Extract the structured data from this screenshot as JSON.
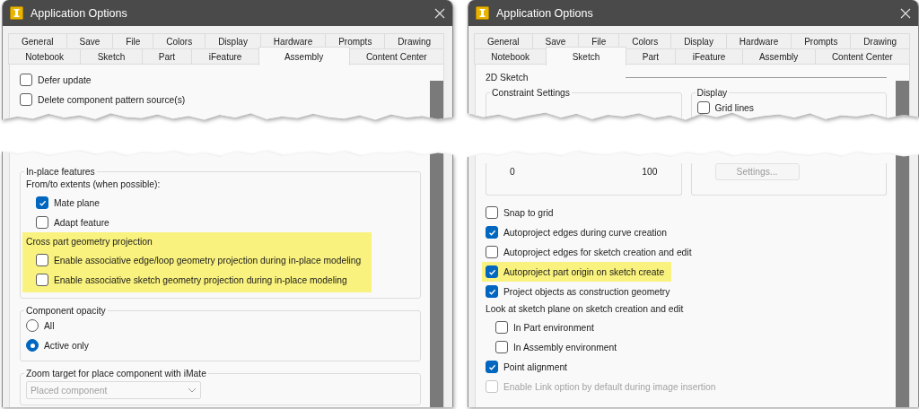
{
  "dialogs": [
    {
      "title": "Application Options",
      "tab_rows": [
        [
          {
            "label": "General",
            "selected": false
          },
          {
            "label": "Save",
            "selected": false
          },
          {
            "label": "File",
            "selected": false
          },
          {
            "label": "Colors",
            "selected": false
          },
          {
            "label": "Display",
            "selected": false
          },
          {
            "label": "Hardware",
            "selected": false
          },
          {
            "label": "Prompts",
            "selected": false
          },
          {
            "label": "Drawing",
            "selected": false
          }
        ],
        [
          {
            "label": "Notebook",
            "selected": false
          },
          {
            "label": "Sketch",
            "selected": false
          },
          {
            "label": "Part",
            "selected": false
          },
          {
            "label": "iFeature",
            "selected": false
          },
          {
            "label": "Assembly",
            "selected": true
          },
          {
            "label": "Content Center",
            "selected": false
          }
        ]
      ],
      "top": {
        "items": [
          {
            "kind": "checkbox",
            "label": "Defer update",
            "checked": false,
            "disabled": false,
            "highlighted": false
          },
          {
            "kind": "checkbox",
            "label": "Delete component pattern source(s)",
            "checked": false,
            "disabled": false,
            "highlighted": false
          }
        ]
      },
      "bottom": {
        "items": [
          {
            "kind": "group",
            "legend": "In-place features",
            "children": [
              {
                "kind": "text",
                "label": "From/to extents (when possible):",
                "highlighted": false,
                "children": [
                  {
                    "kind": "checkbox",
                    "label": "Mate plane",
                    "checked": true,
                    "disabled": false,
                    "highlighted": false
                  },
                  {
                    "kind": "checkbox",
                    "label": "Adapt feature",
                    "checked": false,
                    "disabled": false,
                    "highlighted": false
                  }
                ]
              },
              {
                "kind": "text",
                "label": "Cross part geometry projection",
                "highlighted": true,
                "children": [
                  {
                    "kind": "checkbox",
                    "label": "Enable associative edge/loop geometry projection during in-place modeling",
                    "checked": false,
                    "disabled": false
                  },
                  {
                    "kind": "checkbox",
                    "label": "Enable associative sketch geometry projection during in-place modeling",
                    "checked": false,
                    "disabled": false
                  }
                ]
              }
            ]
          },
          {
            "kind": "group",
            "legend": "Component opacity",
            "children": [
              {
                "kind": "radio",
                "label": "All",
                "selected": false
              },
              {
                "kind": "radio",
                "label": "Active only",
                "selected": true
              }
            ]
          },
          {
            "kind": "group",
            "legend": "Zoom target for place component with iMate",
            "children": [
              {
                "kind": "dropdown",
                "value": "Placed component",
                "disabled": true
              }
            ]
          }
        ]
      }
    },
    {
      "title": "Application Options",
      "tab_rows": [
        [
          {
            "label": "General",
            "selected": false
          },
          {
            "label": "Save",
            "selected": false
          },
          {
            "label": "File",
            "selected": false
          },
          {
            "label": "Colors",
            "selected": false
          },
          {
            "label": "Display",
            "selected": false
          },
          {
            "label": "Hardware",
            "selected": false
          },
          {
            "label": "Prompts",
            "selected": false
          },
          {
            "label": "Drawing",
            "selected": false
          }
        ],
        [
          {
            "label": "Notebook",
            "selected": false
          },
          {
            "label": "Sketch",
            "selected": true
          },
          {
            "label": "Part",
            "selected": false
          },
          {
            "label": "iFeature",
            "selected": false
          },
          {
            "label": "Assembly",
            "selected": false
          },
          {
            "label": "Content Center",
            "selected": false
          }
        ]
      ],
      "top": {
        "items": [
          {
            "kind": "heading",
            "label": "2D Sketch"
          },
          {
            "kind": "columns",
            "children": [
              {
                "kind": "group",
                "legend": "Constraint Settings"
              },
              {
                "kind": "group",
                "legend": "Display",
                "children": [
                  {
                    "kind": "checkbox",
                    "label": "Grid lines",
                    "checked": false,
                    "disabled": false,
                    "highlighted": false
                  }
                ]
              }
            ]
          }
        ]
      },
      "bottom": {
        "items": [
          {
            "kind": "columns",
            "children": [
              {
                "kind": "group",
                "children": [
                  {
                    "kind": "scale",
                    "min": "0",
                    "max": "100"
                  }
                ]
              },
              {
                "kind": "group",
                "children": [
                  {
                    "kind": "button",
                    "label": "Settings...",
                    "disabled": true
                  }
                ]
              }
            ]
          },
          {
            "kind": "checkbox",
            "label": "Snap to grid",
            "checked": false,
            "disabled": false,
            "highlighted": false
          },
          {
            "kind": "checkbox",
            "label": "Autoproject edges during curve creation",
            "checked": true,
            "disabled": false,
            "highlighted": false
          },
          {
            "kind": "checkbox",
            "label": "Autoproject edges for sketch creation and edit",
            "checked": false,
            "disabled": false,
            "highlighted": false
          },
          {
            "kind": "checkbox",
            "label": "Autoproject part origin on sketch create",
            "checked": true,
            "disabled": false,
            "highlighted": true
          },
          {
            "kind": "checkbox",
            "label": "Project objects as construction geometry",
            "checked": true,
            "disabled": false,
            "highlighted": false
          },
          {
            "kind": "text",
            "label": "Look at sketch plane on sketch creation and edit",
            "highlighted": false,
            "children": [
              {
                "kind": "checkbox",
                "label": "In Part environment",
                "checked": false,
                "disabled": false,
                "highlighted": false
              },
              {
                "kind": "checkbox",
                "label": "In Assembly environment",
                "checked": false,
                "disabled": false,
                "highlighted": false
              }
            ]
          },
          {
            "kind": "checkbox",
            "label": "Point alignment",
            "checked": true,
            "disabled": false,
            "highlighted": false
          },
          {
            "kind": "checkbox",
            "label": "Enable Link option by default during image insertion",
            "checked": false,
            "disabled": true,
            "highlighted": false
          }
        ]
      }
    }
  ]
}
